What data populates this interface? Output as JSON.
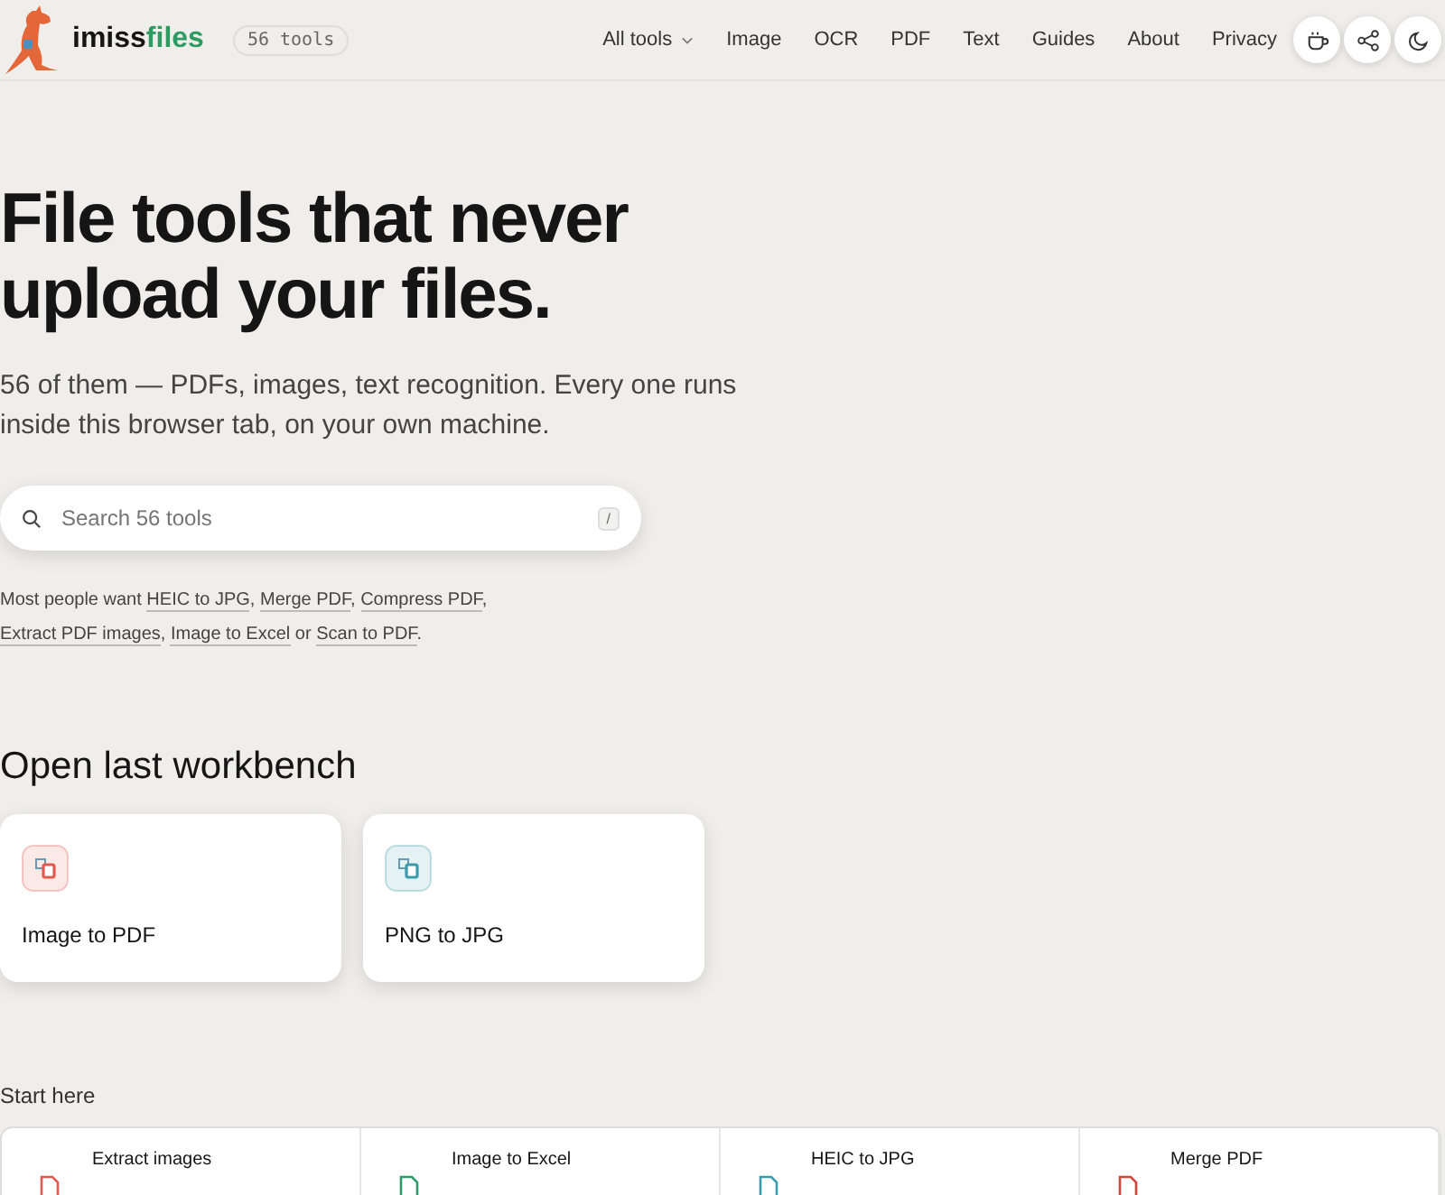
{
  "header": {
    "brand_a": "imiss",
    "brand_b": "files",
    "badge": "56 tools",
    "nav": [
      {
        "label": "All tools",
        "dropdown": true
      },
      {
        "label": "Image",
        "dropdown": false
      },
      {
        "label": "OCR",
        "dropdown": false
      },
      {
        "label": "PDF",
        "dropdown": false
      },
      {
        "label": "Text",
        "dropdown": false
      },
      {
        "label": "Guides",
        "dropdown": false
      },
      {
        "label": "About",
        "dropdown": false
      },
      {
        "label": "Privacy",
        "dropdown": false
      }
    ],
    "icon_buttons": [
      {
        "kind": "coffee"
      },
      {
        "kind": "share"
      },
      {
        "kind": "theme"
      }
    ]
  },
  "hero": {
    "title": "File tools that never upload your files.",
    "subtitle": "56 of them — PDFs, images, text recognition. Every one runs inside this browser tab, on your own machine.",
    "search": {
      "placeholder": "Search 56 tools",
      "shortcut": "/"
    },
    "popular": [
      {
        "kind": "text",
        "text": "Most people want "
      },
      {
        "kind": "link",
        "text": "HEIC to JPG"
      },
      {
        "kind": "text",
        "text": ", "
      },
      {
        "kind": "link",
        "text": "Merge PDF"
      },
      {
        "kind": "text",
        "text": ", "
      },
      {
        "kind": "link",
        "text": "Compress PDF"
      },
      {
        "kind": "text",
        "text": ", "
      },
      {
        "kind": "link",
        "text": "Extract PDF images"
      },
      {
        "kind": "text",
        "text": ", "
      },
      {
        "kind": "link",
        "text": "Image to Excel"
      },
      {
        "kind": "text",
        "text": " or "
      },
      {
        "kind": "link",
        "text": "Scan to PDF"
      },
      {
        "kind": "text",
        "text": "."
      }
    ]
  },
  "workbench": {
    "heading": "Open last workbench",
    "cards": [
      {
        "label": "Image to PDF",
        "color": "#e05a4f"
      },
      {
        "label": "PNG to JPG",
        "color": "#3a9bab"
      }
    ]
  },
  "start": {
    "heading": "Start here",
    "tools": [
      {
        "label": "Extract images",
        "color": "#e05a4f"
      },
      {
        "label": "Image to Excel",
        "color": "#2f9a6a"
      },
      {
        "label": "HEIC to JPG",
        "color": "#3a9bab"
      },
      {
        "label": "Merge PDF",
        "color": "#d0453a"
      }
    ]
  }
}
